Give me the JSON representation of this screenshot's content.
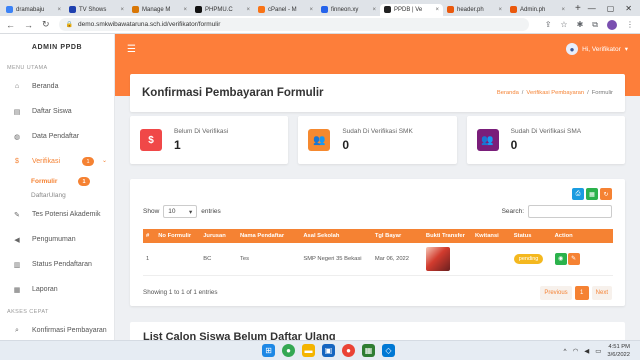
{
  "browser": {
    "tabs": [
      {
        "label": "dramabaju",
        "color": "#3b82f6"
      },
      {
        "label": "TV Shows",
        "color": "#1e40af"
      },
      {
        "label": "Manage M",
        "color": "#d97706"
      },
      {
        "label": "PHPMU.C",
        "color": "#111111"
      },
      {
        "label": "cPanel - M",
        "color": "#f97316"
      },
      {
        "label": "finneon.xy",
        "color": "#2563eb"
      },
      {
        "label": "PPDB | Ve",
        "color": "#222222",
        "active": true
      },
      {
        "label": "header.ph",
        "color": "#ea580c"
      },
      {
        "label": "Admin.ph",
        "color": "#ea580c"
      }
    ],
    "url": "demo.smkwibawataruna.sch.id/verifikator/formulir"
  },
  "sidebar": {
    "brand": "ADMIN PPDB",
    "section_main": "MENU UTAMA",
    "section_quick": "AKSES CEPAT",
    "items": [
      {
        "label": "Beranda",
        "icon": "home-icon",
        "glyph": "⌂"
      },
      {
        "label": "Daftar Siswa",
        "icon": "document-icon",
        "glyph": "▤"
      },
      {
        "label": "Data Pendaftar",
        "icon": "users-icon",
        "glyph": "◍"
      },
      {
        "label": "Verifikasi",
        "icon": "dollar-icon",
        "glyph": "$",
        "badge": "1",
        "active": true
      }
    ],
    "sub_items": [
      {
        "label": "Formulir",
        "badge": "1",
        "active": true
      },
      {
        "label": "DaftarUlang"
      }
    ],
    "items2": [
      {
        "label": "Tes Potensi Akademik",
        "icon": "user-edit-icon",
        "glyph": "✎"
      },
      {
        "label": "Pengumuman",
        "icon": "megaphone-icon",
        "glyph": "◀"
      },
      {
        "label": "Status Pendaftaran",
        "icon": "chart-icon",
        "glyph": "▥"
      },
      {
        "label": "Laporan",
        "icon": "report-icon",
        "glyph": "▦"
      }
    ],
    "quick": [
      {
        "label": "Konfirmasi Pembayaran",
        "icon": "search-icon",
        "glyph": "⌕"
      }
    ]
  },
  "topbar": {
    "user": "Hi, Verifikator"
  },
  "page": {
    "title": "Konfirmasi Pembayaran Formulir",
    "crumbs": [
      "Beranda",
      "/",
      "Verifikasi Pembayaran",
      "/",
      "Formulir"
    ]
  },
  "cards": [
    {
      "label": "Belum Di Verifikasi",
      "value": "1",
      "color": "#f04848",
      "glyph": "$"
    },
    {
      "label": "Sudah Di Verifikasi SMK",
      "value": "0",
      "color": "#f5892f",
      "glyph": "👥"
    },
    {
      "label": "Sudah Di Verifikasi SMA",
      "value": "0",
      "color": "#7a1e7a",
      "glyph": "👥"
    }
  ],
  "table": {
    "show_label": "Show",
    "entries_value": "10",
    "entries_label": "entries",
    "search_label": "Search:",
    "headers": [
      "#",
      "No Formulir",
      "Jurusan",
      "Nama Pendaftar",
      "Asal Sekolah",
      "Tgl Bayar",
      "Bukti Transfer",
      "Kwitansi",
      "Status",
      "Action"
    ],
    "rows": [
      {
        "no": "1",
        "formulir": "",
        "jurusan": "BC",
        "nama": "Tes",
        "asal": "SMP Negeri 35 Bekasi",
        "tgl": "Mar 06, 2022",
        "kwitansi": "",
        "status": "pending"
      }
    ],
    "info": "Showing 1 to 1 of 1 entries",
    "prev": "Previous",
    "page": "1",
    "next": "Next"
  },
  "panel2": {
    "title": "List Calon Siswa Belum Daftar Ulang"
  },
  "taskbar": {
    "time": "4:51 PM",
    "date": "3/6/2022",
    "caret": "^"
  }
}
